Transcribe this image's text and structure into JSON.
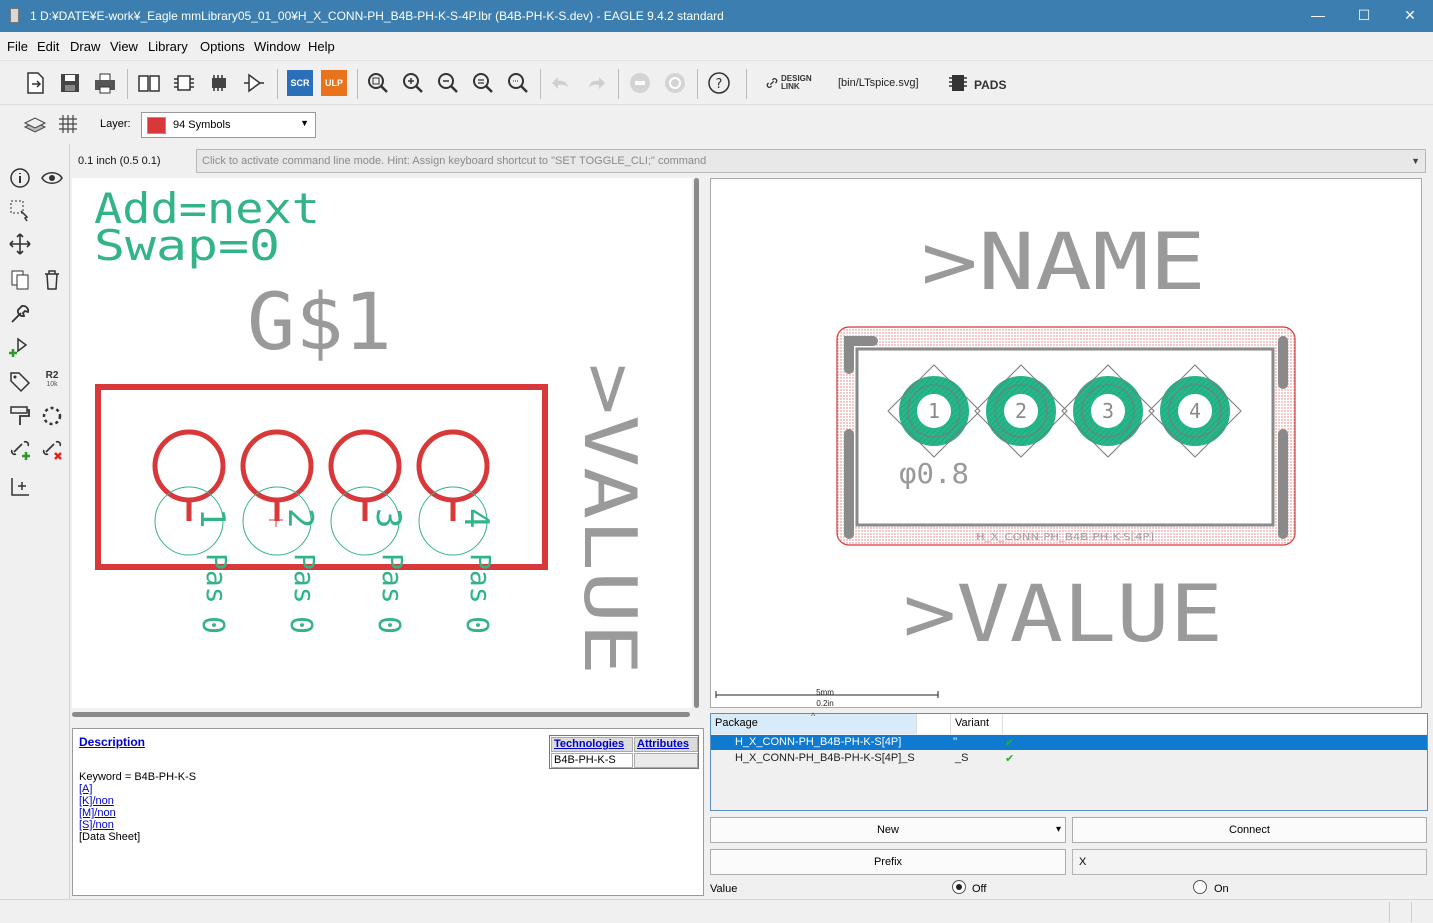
{
  "window": {
    "title": "1 D:¥DATE¥E-work¥_Eagle mmLibrary05_01_00¥H_X_CONN-PH_B4B-PH-K-S-4P.lbr (B4B-PH-K-S.dev) - EAGLE 9.4.2 standard",
    "minimize": "—",
    "maximize": "☐",
    "close": "✕"
  },
  "menu": [
    "File",
    "Edit",
    "Draw",
    "View",
    "Library",
    "Options",
    "Window",
    "Help"
  ],
  "toolbar": {
    "scr_label": "SCR",
    "ulp_label": "ULP",
    "design_link_line1": "DESIGN",
    "design_link_line2": "LINK",
    "script_path": "[bin/LTspice.svg]",
    "pads_label": "PADS"
  },
  "layer": {
    "label": "Layer:",
    "selected": "94 Symbols",
    "color": "#d9383a"
  },
  "lefttools": {
    "r2_label": "R2",
    "r2_sub": "10k"
  },
  "coords": "0.1 inch (0.5 0.1)",
  "cmdline_hint": "Click to activate command line mode. Hint: Assign keyboard shortcut to \"SET TOGGLE_CLI;\" command",
  "symbol": {
    "add_text": "Add=next",
    "swap_text": "Swap=0",
    "gate_name": "G$1",
    "value_text": ">VALUE",
    "pins": [
      "1",
      "2",
      "3",
      "4"
    ],
    "pin_suffix": "Pas 0",
    "frame_color": "#d9383a",
    "pin_text_color": "#33b38a"
  },
  "package": {
    "name_text": ">NAME",
    "value_text": ">VALUE",
    "drill_text": "φ0.8",
    "pkg_label": "H_X_CONN-PH_B4B-PH-K-S[4P]",
    "pads": [
      "1",
      "2",
      "3",
      "4"
    ],
    "scale_top": "5mm",
    "scale_bottom": "0.2in",
    "pad_color": "#27b58a",
    "outline_color": "#8a8a8a"
  },
  "description": {
    "title": "Description",
    "keyword": "Keyword = B4B-PH-K-S",
    "lines": [
      "[A]",
      "[K]/non",
      "[M]/non",
      "[S]/non"
    ],
    "datasheet": "[Data Sheet]",
    "tech_header": "Technologies",
    "attr_header": "Attributes",
    "tech_value": "B4B-PH-K-S"
  },
  "package_table": {
    "col_package": "Package",
    "col_variant": "Variant",
    "rows": [
      {
        "package": "H_X_CONN-PH_B4B-PH-K-S[4P]",
        "variant": "''",
        "check": "✔",
        "selected": true
      },
      {
        "package": "H_X_CONN-PH_B4B-PH-K-S[4P]_S",
        "variant": "_S",
        "check": "✔",
        "selected": false
      }
    ]
  },
  "buttons": {
    "new": "New",
    "new_arrow": "▾",
    "connect": "Connect",
    "prefix": "Prefix",
    "prefix_value": "X"
  },
  "value_option": {
    "label": "Value",
    "off": "Off",
    "on": "On",
    "selected": "Off"
  }
}
